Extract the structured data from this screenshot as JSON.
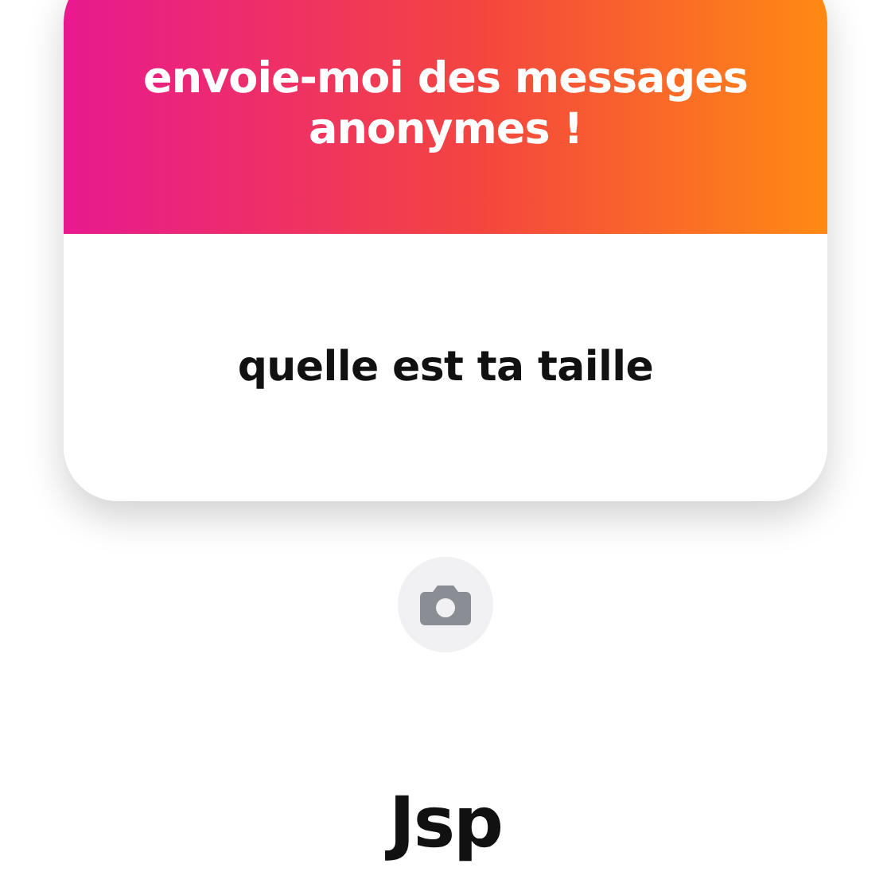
{
  "card": {
    "title": "envoie-moi des messages anonymes !",
    "question": "quelle est ta taille"
  },
  "answer": "Jsp"
}
